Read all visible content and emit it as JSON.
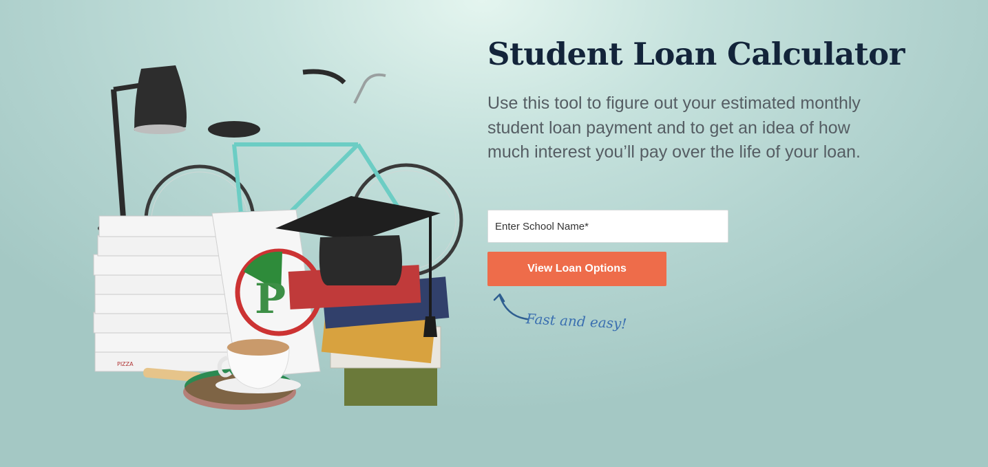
{
  "hero": {
    "title": "Student Loan Calculator",
    "description": "Use this tool to figure out your estimated monthly student loan payment and to get an idea of how much interest you’ll pay over the life of your loan.",
    "school_input": {
      "placeholder": "Enter School Name*",
      "value": ""
    },
    "cta_label": "View Loan Options",
    "annotation": "Fast and easy!",
    "image_text": {
      "box_label": "PIZZA"
    }
  },
  "colors": {
    "background": "#c6e2dd",
    "title": "#13243a",
    "body_text": "#555d63",
    "cta": "#ee6c4a",
    "annotation": "#3a6fb0"
  },
  "icons": [
    "desk-lamp",
    "bicycle",
    "pizza-boxes",
    "graduation-cap",
    "books",
    "coffee-cup",
    "ping-pong-paddle",
    "curved-arrow"
  ]
}
